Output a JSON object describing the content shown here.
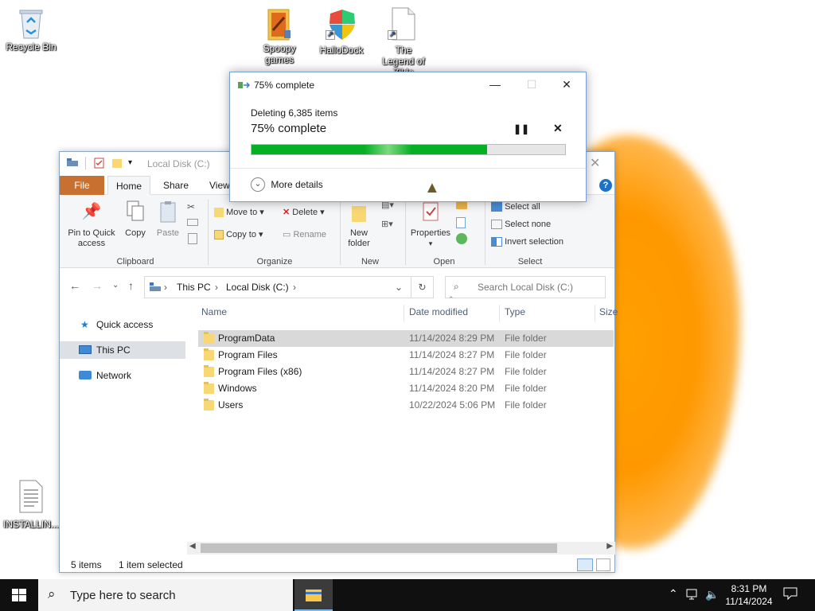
{
  "desktop": {
    "icons": [
      {
        "label": "Recycle Bin",
        "icon": "recycle-bin-icon"
      },
      {
        "label": "Spoopy games",
        "icon": "folder-icon"
      },
      {
        "label": "HalloDock",
        "icon": "shield-icon"
      },
      {
        "label": "The Legend of Zilda",
        "icon": "file-icon"
      },
      {
        "label": "INSTALLIN...",
        "icon": "text-file-icon"
      }
    ]
  },
  "dialog": {
    "title": "75% complete",
    "line1": "Deleting 6,385 items",
    "line2": "75% complete",
    "progress": 0.75,
    "more_details": "More details",
    "progress_color": "#06b025"
  },
  "explorer": {
    "title": "Local Disk (C:)",
    "tabs": [
      "File",
      "Home",
      "Share",
      "View"
    ],
    "ribbon": {
      "pin": "Pin to Quick access",
      "copy": "Copy",
      "paste": "Paste",
      "move_to": "Move to",
      "copy_to": "Copy to",
      "delete": "Delete",
      "rename": "Rename",
      "new_folder": "New folder",
      "properties": "Properties",
      "select_all": "Select all",
      "select_none": "Select none",
      "invert_selection": "Invert selection",
      "groups": [
        "Clipboard",
        "Organize",
        "New",
        "Open",
        "Select"
      ]
    },
    "breadcrumb": [
      "This PC",
      "Local Disk (C:)"
    ],
    "search_placeholder": "Search Local Disk (C:)",
    "nav": [
      "Quick access",
      "This PC",
      "Network"
    ],
    "columns": [
      "Name",
      "Date modified",
      "Type",
      "Size"
    ],
    "rows": [
      {
        "name": "ProgramData",
        "date": "11/14/2024 8:29 PM",
        "type": "File folder",
        "selected": true
      },
      {
        "name": "Program Files",
        "date": "11/14/2024 8:27 PM",
        "type": "File folder",
        "selected": false
      },
      {
        "name": "Program Files (x86)",
        "date": "11/14/2024 8:27 PM",
        "type": "File folder",
        "selected": false
      },
      {
        "name": "Windows",
        "date": "11/14/2024 8:20 PM",
        "type": "File folder",
        "selected": false
      },
      {
        "name": "Users",
        "date": "10/22/2024 5:06 PM",
        "type": "File folder",
        "selected": false
      }
    ],
    "status_items": "5 items",
    "status_selected": "1 item selected"
  },
  "taskbar": {
    "search_placeholder": "Type here to search",
    "time": "8:31 PM",
    "date": "11/14/2024"
  }
}
